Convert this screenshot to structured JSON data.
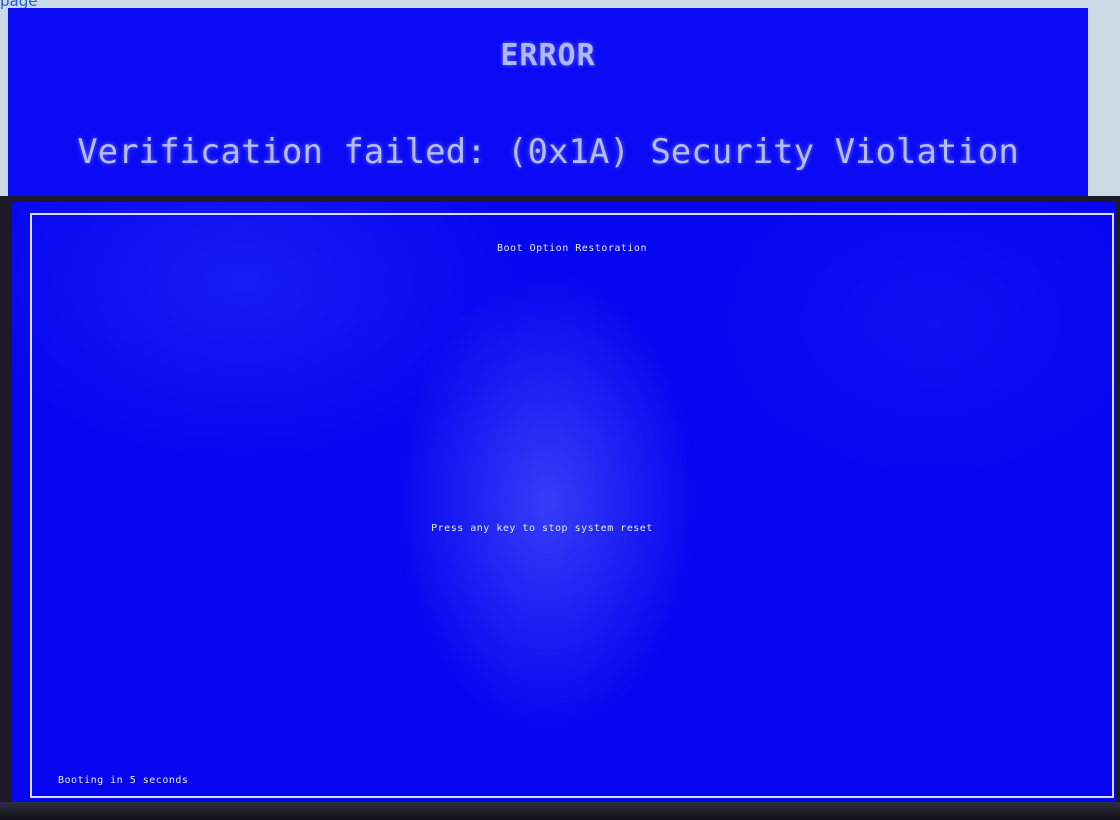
{
  "header_link": "page",
  "error_banner": {
    "title": "ERROR",
    "message": "Verification failed: (0x1A) Security Violation"
  },
  "boot_screen": {
    "title": "Boot Option Restoration",
    "prompt": "Press any key to stop system reset",
    "countdown": "Booting in 5 seconds"
  },
  "colors": {
    "screen_blue": "#0606f0",
    "text": "#e6e8ff",
    "banner_blue": "#0a0af5"
  }
}
